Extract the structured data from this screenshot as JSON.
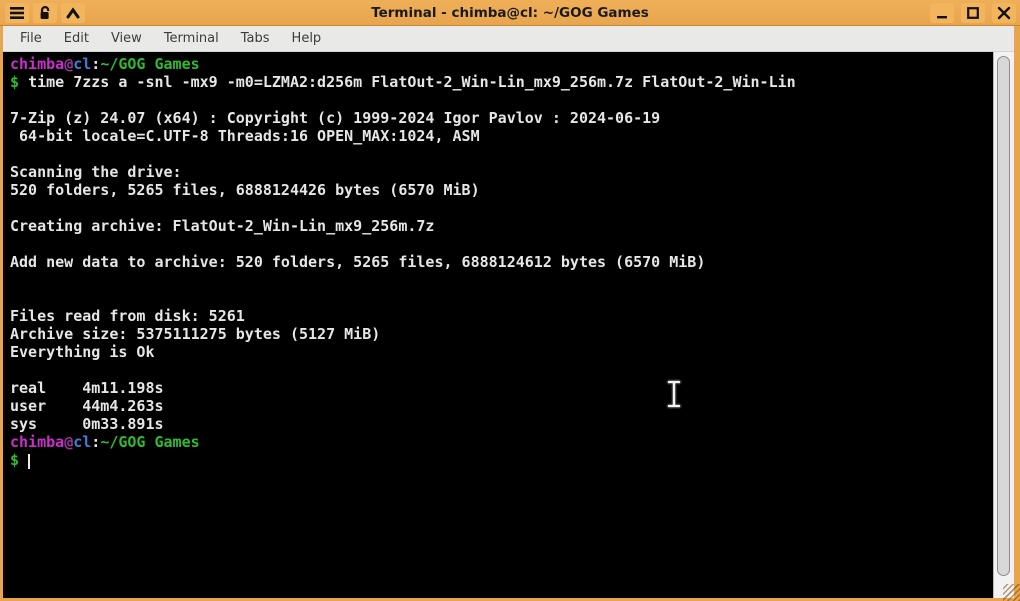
{
  "window": {
    "title": "Terminal - chimba@cl: ~/GOG Games",
    "titlebar_icons": [
      "hamburger-menu-icon",
      "unlock-icon",
      "collapse-up-icon"
    ],
    "control_icons": [
      "minimize-icon",
      "maximize-icon",
      "close-icon"
    ]
  },
  "menubar": {
    "items": [
      "File",
      "Edit",
      "View",
      "Terminal",
      "Tabs",
      "Help"
    ]
  },
  "terminal": {
    "prompt": {
      "user": "chimba",
      "host": "cl",
      "cwd": "~/GOG Games",
      "symbol": "$"
    },
    "lines": [
      [
        {
          "c": "user",
          "t": "chimba"
        },
        {
          "c": "at",
          "t": "@"
        },
        {
          "c": "host",
          "t": "cl"
        },
        {
          "c": "fg",
          "t": ":"
        },
        {
          "c": "path",
          "t": "~/GOG Games"
        }
      ],
      [
        {
          "c": "dollar",
          "t": "$ "
        },
        {
          "c": "fg",
          "t": "time 7zzs a -snl -mx9 -m0=LZMA2:d256m FlatOut-2_Win-Lin_mx9_256m.7z FlatOut-2_Win-Lin"
        }
      ],
      [],
      [
        {
          "c": "fg",
          "t": "7-Zip (z) 24.07 (x64) : Copyright (c) 1999-2024 Igor Pavlov : 2024-06-19"
        }
      ],
      [
        {
          "c": "fg",
          "t": " 64-bit locale=C.UTF-8 Threads:16 OPEN_MAX:1024, ASM"
        }
      ],
      [],
      [
        {
          "c": "fg",
          "t": "Scanning the drive:"
        }
      ],
      [
        {
          "c": "fg",
          "t": "520 folders, 5265 files, 6888124426 bytes (6570 MiB)"
        }
      ],
      [],
      [
        {
          "c": "fg",
          "t": "Creating archive: FlatOut-2_Win-Lin_mx9_256m.7z"
        }
      ],
      [],
      [
        {
          "c": "fg",
          "t": "Add new data to archive: 520 folders, 5265 files, 6888124612 bytes (6570 MiB)"
        }
      ],
      [],
      [],
      [
        {
          "c": "fg",
          "t": "Files read from disk: 5261"
        }
      ],
      [
        {
          "c": "fg",
          "t": "Archive size: 5375111275 bytes (5127 MiB)"
        }
      ],
      [
        {
          "c": "fg",
          "t": "Everything is Ok"
        }
      ],
      [],
      [
        {
          "c": "fg",
          "t": "real    4m11.198s"
        }
      ],
      [
        {
          "c": "fg",
          "t": "user    44m4.263s"
        }
      ],
      [
        {
          "c": "fg",
          "t": "sys     0m33.891s"
        }
      ],
      [
        {
          "c": "user",
          "t": "chimba"
        },
        {
          "c": "at",
          "t": "@"
        },
        {
          "c": "host",
          "t": "cl"
        },
        {
          "c": "fg",
          "t": ":"
        },
        {
          "c": "path",
          "t": "~/GOG Games"
        }
      ],
      [
        {
          "c": "dollar",
          "t": "$ "
        },
        {
          "c": "cursor",
          "t": ""
        }
      ]
    ]
  },
  "colors": {
    "bg": "#000000",
    "fg": "#e6e6e6",
    "user": "#cb2fcb",
    "at": "#9c35a0",
    "host": "#3d7fd9",
    "path": "#2fbb2f",
    "symbol": "#2fbb2f",
    "titlebar": "#e8a54e",
    "titlebar_button": "#f2b55e",
    "titlebar_text": "#1a1a1a",
    "menubar": "#e9e9e7",
    "menubar_text": "#3c3c3c",
    "scrollbar_track": "#f2f2f2",
    "scrollbar_thumb": "#d8d8d8",
    "border_orange": "#e8a54e"
  }
}
